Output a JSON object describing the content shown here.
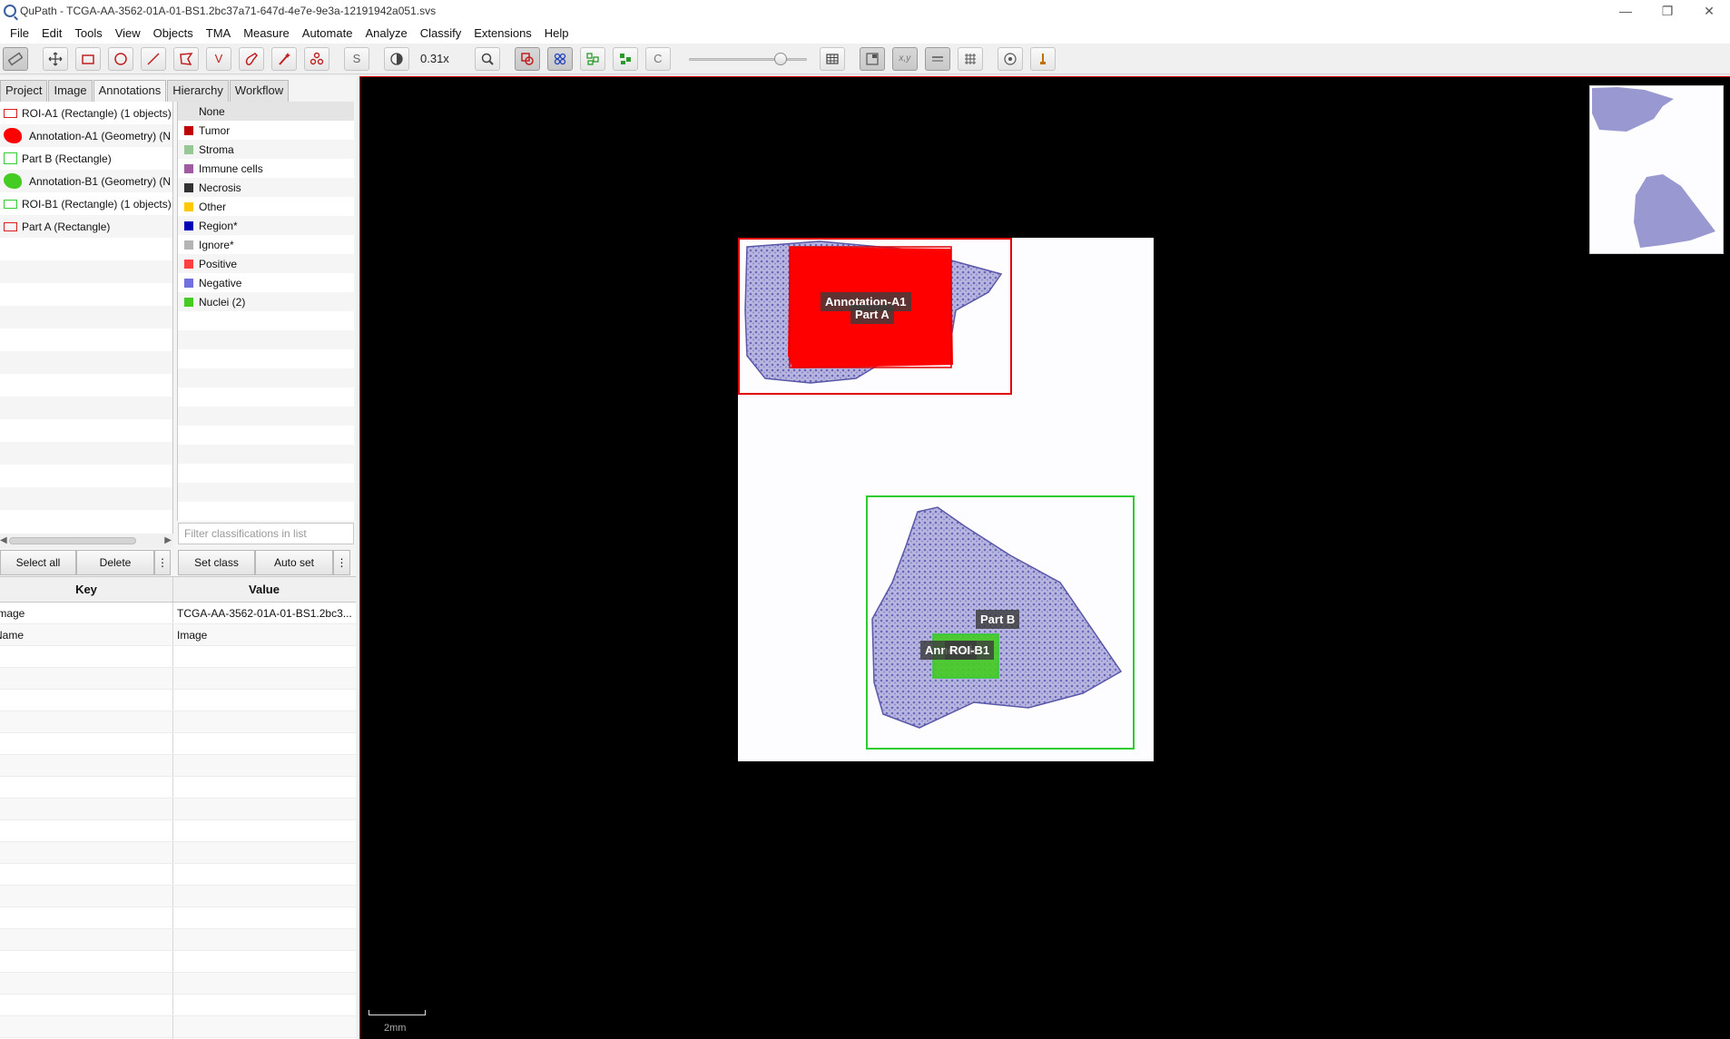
{
  "window": {
    "title": "QuPath - TCGA-AA-3562-01A-01-BS1.2bc37a71-647d-4e7e-9e3a-12191942a051.svs",
    "controls": [
      "—",
      "❐",
      "✕"
    ]
  },
  "menu": [
    "File",
    "Edit",
    "Tools",
    "View",
    "Objects",
    "TMA",
    "Measure",
    "Automate",
    "Analyze",
    "Classify",
    "Extensions",
    "Help"
  ],
  "toolbar": {
    "zoom": "0.31x",
    "brush_label": "S",
    "wand_label": "V",
    "c_label": "C",
    "xy_label": "x,y",
    "opacity_slider": 0.78
  },
  "tabs": [
    "Project",
    "Image",
    "Annotations",
    "Hierarchy",
    "Workflow"
  ],
  "active_tab": "Annotations",
  "annotations": [
    {
      "label": "ROI-A1 (Rectangle) (1 objects)",
      "kind": "rect",
      "color": "#d62020"
    },
    {
      "label": "Annotation-A1 (Geometry) (N",
      "kind": "blob",
      "color": "#ff0000"
    },
    {
      "label": "Part B (Rectangle)",
      "kind": "rect",
      "color": "#33cc33"
    },
    {
      "label": "Annotation-B1 (Geometry) (N",
      "kind": "blob",
      "color": "#44cc22"
    },
    {
      "label": "ROI-B1 (Rectangle) (1 objects)",
      "kind": "rect",
      "color": "#33cc33"
    },
    {
      "label": "Part A (Rectangle)",
      "kind": "rect",
      "color": "#d62020"
    }
  ],
  "classes": {
    "header": "None",
    "items": [
      {
        "name": "Tumor",
        "color": "#c00000"
      },
      {
        "name": "Stroma",
        "color": "#96c896"
      },
      {
        "name": "Immune cells",
        "color": "#a05aa0"
      },
      {
        "name": "Necrosis",
        "color": "#323232"
      },
      {
        "name": "Other",
        "color": "#ffc800"
      },
      {
        "name": "Region*",
        "color": "#0000b4"
      },
      {
        "name": "Ignore*",
        "color": "#b4b4b4"
      },
      {
        "name": "Positive",
        "color": "#ff4040"
      },
      {
        "name": "Negative",
        "color": "#7070e0"
      },
      {
        "name": "Nuclei (2)",
        "color": "#44cc22"
      }
    ],
    "filter_placeholder": "Filter classifications in list"
  },
  "buttons": {
    "select_all": "Select all",
    "delete": "Delete",
    "more": "⋮",
    "set_class": "Set class",
    "auto_set": "Auto set"
  },
  "table": {
    "key_header": "Key",
    "value_header": "Value",
    "rows": [
      {
        "key": "Image",
        "value": "TCGA-AA-3562-01A-01-BS1.2bc3..."
      },
      {
        "key": "Name",
        "value": "Image"
      }
    ]
  },
  "viewer": {
    "labels": {
      "annotation_a1": "Annotation-A1",
      "part_a": "Part A",
      "part_b": "Part B",
      "annotation_b1": "Annotation-B1",
      "roi_b1": "ROI-B1"
    },
    "scalebar": "2mm",
    "colors": {
      "red": "#e00000",
      "green": "#2ecc2e",
      "tissue": "#7a78c0"
    }
  }
}
